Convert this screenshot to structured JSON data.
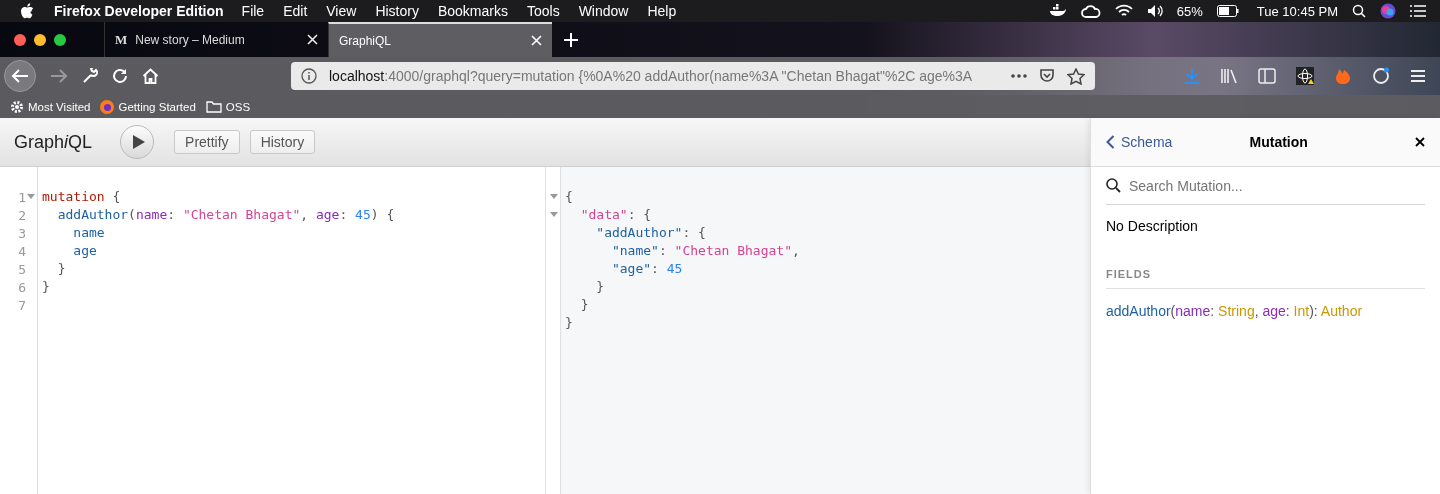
{
  "menubar": {
    "app": "Firefox Developer Edition",
    "menus": [
      "File",
      "Edit",
      "View",
      "History",
      "Bookmarks",
      "Tools",
      "Window",
      "Help"
    ],
    "battery": "65%",
    "clock": "Tue 10:45 PM"
  },
  "tabs": [
    {
      "favicon": "M",
      "title": "New story – Medium",
      "selected": false
    },
    {
      "title": "GraphiQL",
      "selected": true
    }
  ],
  "address_bar": {
    "host": "localhost",
    "path": ":4000/graphql?query=mutation {%0A%20 addAuthor(name%3A \"Chetan Bhagat\"%2C age%3A"
  },
  "bookmarks": [
    {
      "kind": "gear",
      "label": "Most Visited"
    },
    {
      "kind": "firefox",
      "label": "Getting Started"
    },
    {
      "kind": "folder",
      "label": "OSS"
    }
  ],
  "graphiql": {
    "title": "Graph",
    "title_italic": "i",
    "title_end": "QL",
    "buttons": [
      "Prettify",
      "History"
    ],
    "query_lines": [
      {
        "number": "1",
        "foldable": true,
        "tokens": [
          {
            "t": "mutation",
            "kind": "keyword"
          },
          {
            "t": " {",
            "kind": "punct"
          }
        ]
      },
      {
        "number": "2",
        "foldable": false,
        "tokens": [
          {
            "t": "  addAuthor",
            "kind": "def"
          },
          {
            "t": "(",
            "kind": "punct"
          },
          {
            "t": "name",
            "kind": "attr"
          },
          {
            "t": ": ",
            "kind": "punct"
          },
          {
            "t": "\"Chetan Bhagat\"",
            "kind": "string"
          },
          {
            "t": ", ",
            "kind": "punct"
          },
          {
            "t": "age",
            "kind": "attr"
          },
          {
            "t": ": ",
            "kind": "punct"
          },
          {
            "t": "45",
            "kind": "number"
          },
          {
            "t": ") {",
            "kind": "punct"
          }
        ]
      },
      {
        "number": "3",
        "foldable": false,
        "tokens": [
          {
            "t": "    name",
            "kind": "property"
          }
        ]
      },
      {
        "number": "4",
        "foldable": false,
        "tokens": [
          {
            "t": "    age",
            "kind": "property"
          }
        ]
      },
      {
        "number": "5",
        "foldable": false,
        "tokens": [
          {
            "t": "  }",
            "kind": "punct"
          }
        ]
      },
      {
        "number": "6",
        "foldable": false,
        "tokens": [
          {
            "t": "}",
            "kind": "punct"
          }
        ]
      },
      {
        "number": "7",
        "foldable": false
      }
    ],
    "result_lines": [
      {
        "foldable": true,
        "tokens": [
          {
            "t": "{",
            "kind": "punct"
          }
        ]
      },
      {
        "foldable": true,
        "tokens": [
          {
            "t": "  \"data\"",
            "kind": "string"
          },
          {
            "t": ": {",
            "kind": "punct"
          }
        ]
      },
      {
        "foldable": false,
        "tokens": [
          {
            "t": "    \"addAuthor\"",
            "kind": "def"
          },
          {
            "t": ": {",
            "kind": "punct"
          }
        ]
      },
      {
        "foldable": false,
        "tokens": [
          {
            "t": "      \"name\"",
            "kind": "def"
          },
          {
            "t": ": ",
            "kind": "punct"
          },
          {
            "t": "\"Chetan Bhagat\"",
            "kind": "string"
          },
          {
            "t": ",",
            "kind": "punct"
          }
        ]
      },
      {
        "foldable": false,
        "tokens": [
          {
            "t": "      \"age\"",
            "kind": "def"
          },
          {
            "t": ": ",
            "kind": "punct"
          },
          {
            "t": "45",
            "kind": "number"
          }
        ]
      },
      {
        "foldable": false,
        "tokens": [
          {
            "t": "    }",
            "kind": "punct"
          }
        ]
      },
      {
        "foldable": false,
        "tokens": [
          {
            "t": "  }",
            "kind": "punct"
          }
        ]
      },
      {
        "foldable": false,
        "tokens": [
          {
            "t": "}",
            "kind": "punct"
          }
        ]
      }
    ],
    "docs": {
      "back": "Schema",
      "title": "Mutation",
      "search_placeholder": "Search Mutation...",
      "description": "No Description",
      "section": "FIELDS",
      "field": [
        {
          "t": "addAuthor",
          "kind": "def"
        },
        {
          "t": "(",
          "kind": "punct"
        },
        {
          "t": "name",
          "kind": "attr"
        },
        {
          "t": ": ",
          "kind": "punct"
        },
        {
          "t": "String",
          "kind": "type"
        },
        {
          "t": ", ",
          "kind": "punct"
        },
        {
          "t": "age",
          "kind": "attr"
        },
        {
          "t": ": ",
          "kind": "punct"
        },
        {
          "t": "Int",
          "kind": "type"
        },
        {
          "t": "): ",
          "kind": "punct"
        },
        {
          "t": "Author",
          "kind": "type"
        }
      ]
    }
  }
}
